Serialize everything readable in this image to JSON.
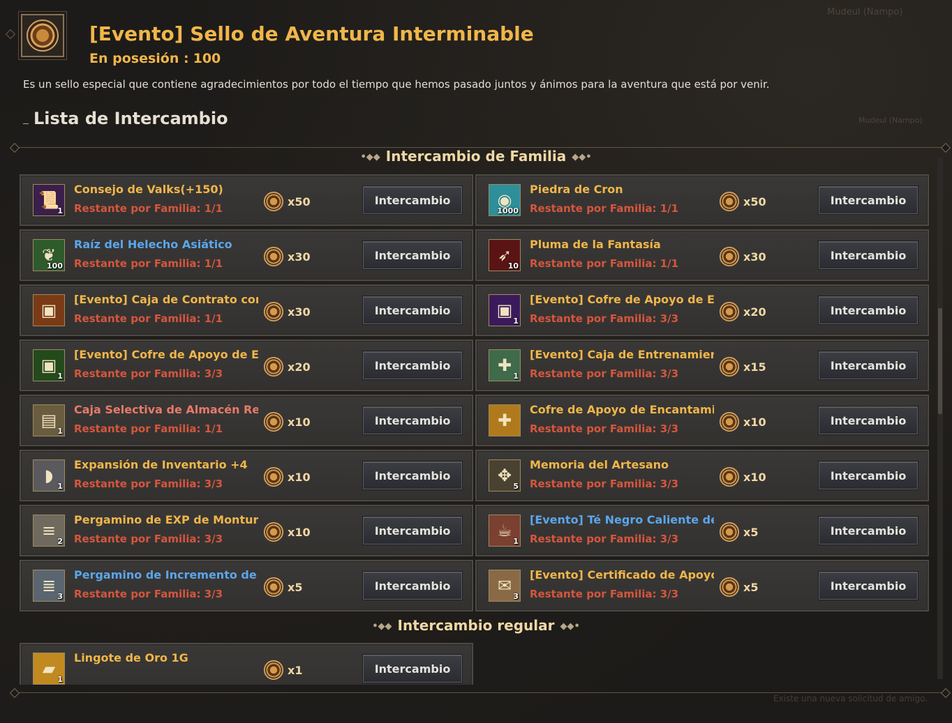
{
  "header": {
    "title": "[Evento] Sello de Aventura Interminable",
    "possession_label": "En posesión :",
    "possession_value": "100",
    "description": "Es un sello especial que contiene agradecimientos por todo el tiempo que hemos pasado juntos y ánimos para la aventura que está por venir.",
    "list_title": "Lista de Intercambio"
  },
  "background_text": {
    "top_right": "Mudeul (Nampo)",
    "mid_right": "Mudeul (Nampo)",
    "bottom_right": "Existe una nueva solicitud de amigo."
  },
  "sections": {
    "family": "Intercambio de Familia",
    "regular": "Intercambio regular"
  },
  "button_label": "Intercambio",
  "icon_names": [
    "seal-icon",
    "coin-icon"
  ],
  "colors": {
    "title": "#f0b64a",
    "remaining": "#d5563e",
    "blue_item": "#5aa6ec"
  },
  "family_items": [
    {
      "name": "Consejo de Valks(+150)",
      "remaining": "Restante por Familia: 1/1",
      "cost": "x50",
      "qty": "1",
      "icon": "scroll-icon",
      "color": "gold"
    },
    {
      "name": "Piedra de Cron",
      "remaining": "Restante por Familia: 1/1",
      "cost": "x50",
      "qty": "1000",
      "icon": "crystal-icon",
      "color": "gold"
    },
    {
      "name": "Raíz del Helecho Asiático",
      "remaining": "Restante por Familia: 1/1",
      "cost": "x30",
      "qty": "100",
      "icon": "fern-icon",
      "color": "blue"
    },
    {
      "name": "Pluma de la Fantasía",
      "remaining": "Restante por Familia: 1/1",
      "cost": "x30",
      "qty": "10",
      "icon": "feather-icon",
      "color": "gold"
    },
    {
      "name": "[Evento] Caja de Contrato con A...",
      "remaining": "Restante por Familia: 1/1",
      "cost": "x30",
      "qty": "",
      "icon": "chest-icon",
      "color": "gold"
    },
    {
      "name": "[Evento] Cofre de Apoyo de Enc...",
      "remaining": "Restante por Familia: 3/3",
      "cost": "x20",
      "qty": "1",
      "icon": "purple-box-icon",
      "color": "gold"
    },
    {
      "name": "[Evento] Cofre de Apoyo de Enc...",
      "remaining": "Restante por Familia: 3/3",
      "cost": "x20",
      "qty": "1",
      "icon": "green-box-icon",
      "color": "gold"
    },
    {
      "name": "[Evento] Caja de Entrenamiento ...",
      "remaining": "Restante por Familia: 3/3",
      "cost": "x15",
      "qty": "1",
      "icon": "gift-icon",
      "color": "gold"
    },
    {
      "name": "Caja Selectiva de Almacén Respl...",
      "remaining": "Restante por Familia: 1/1",
      "cost": "x10",
      "qty": "1",
      "icon": "storage-box-icon",
      "color": "red"
    },
    {
      "name": "Cofre de Apoyo de Encantamien...",
      "remaining": "Restante por Familia: 3/3",
      "cost": "x10",
      "qty": "",
      "icon": "golden-gift-icon",
      "color": "gold"
    },
    {
      "name": "Expansión de Inventario +4",
      "remaining": "Restante por Familia: 3/3",
      "cost": "x10",
      "qty": "1",
      "icon": "bag-icon",
      "color": "gold"
    },
    {
      "name": "Memoria del Artesano",
      "remaining": "Restante por Familia: 3/3",
      "cost": "x10",
      "qty": "5",
      "icon": "pendant-icon",
      "color": "gold"
    },
    {
      "name": "Pergamino de EXP de Montura E...",
      "remaining": "Restante por Familia: 3/3",
      "cost": "x10",
      "qty": "2",
      "icon": "mount-scroll-icon",
      "color": "gold"
    },
    {
      "name": "[Evento] Té Negro Caliente de L...",
      "remaining": "Restante por Familia: 3/3",
      "cost": "x5",
      "qty": "1",
      "icon": "tea-icon",
      "color": "blue"
    },
    {
      "name": "Pergamino de Incremento de Dr...",
      "remaining": "Restante por Familia: 3/3",
      "cost": "x5",
      "qty": "3",
      "icon": "drop-scroll-icon",
      "color": "blue"
    },
    {
      "name": "[Evento] Certificado de Apoyo d...",
      "remaining": "Restante por Familia: 3/3",
      "cost": "x5",
      "qty": "3",
      "icon": "certificate-icon",
      "color": "gold"
    }
  ],
  "regular_items": [
    {
      "name": "Lingote de Oro 1G",
      "remaining": "",
      "cost": "x1",
      "qty": "1",
      "icon": "gold-bar-icon",
      "color": "gold"
    }
  ]
}
